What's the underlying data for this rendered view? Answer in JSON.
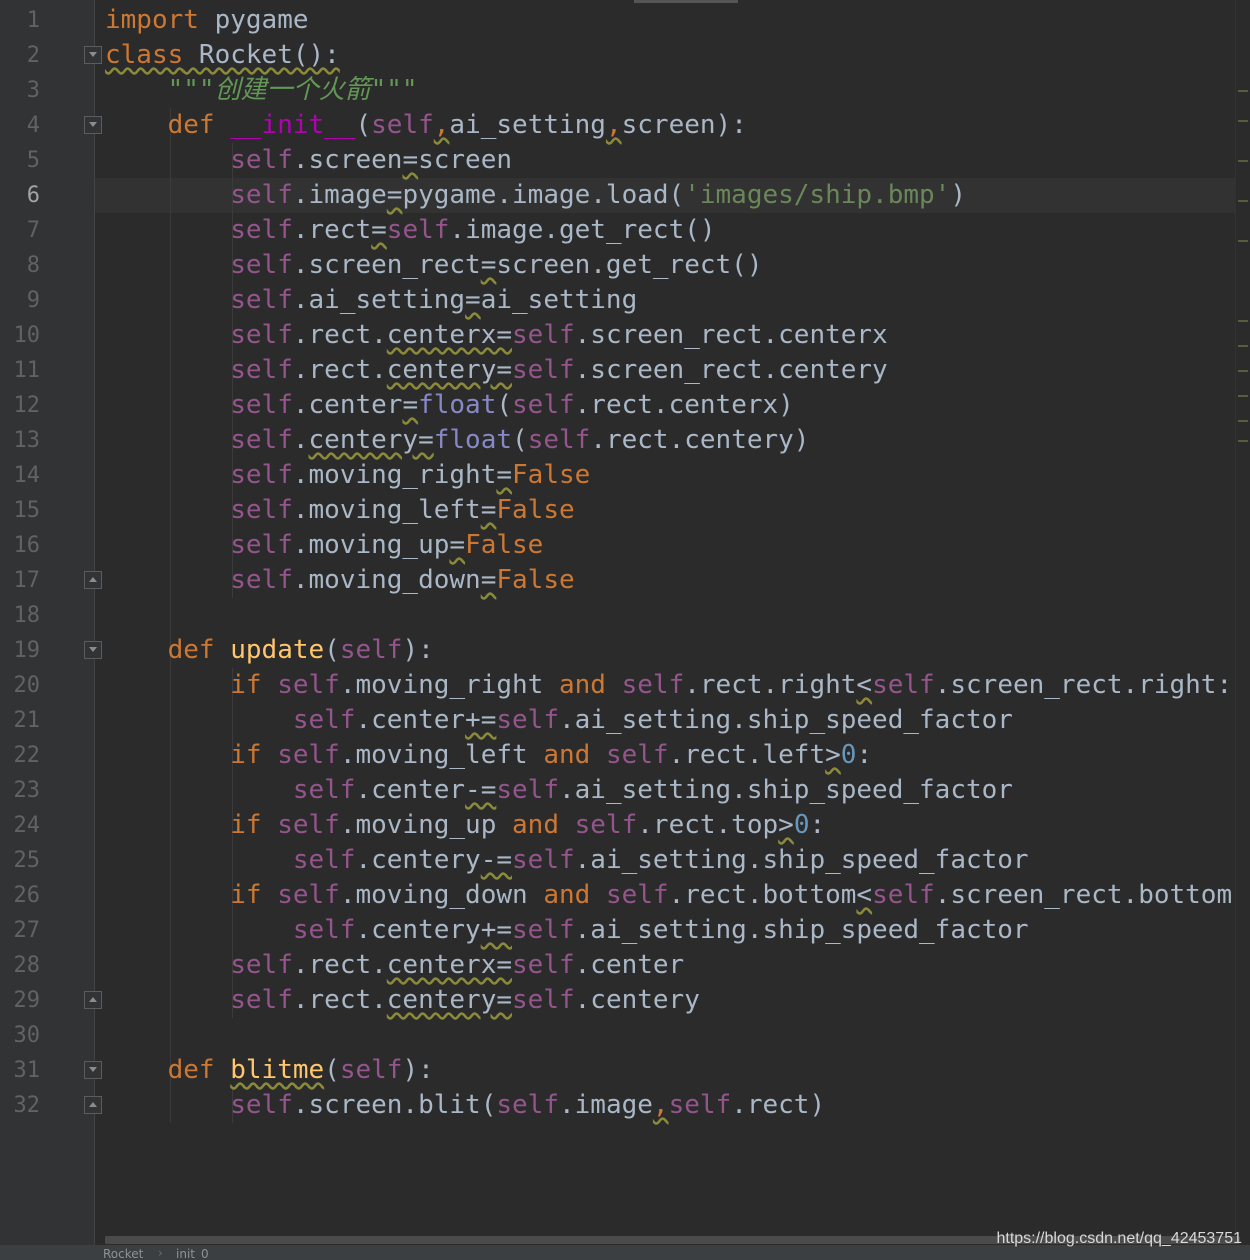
{
  "editor": {
    "line_numbers": [
      "1",
      "2",
      "3",
      "4",
      "5",
      "6",
      "7",
      "8",
      "9",
      "10",
      "11",
      "12",
      "13",
      "14",
      "15",
      "16",
      "17",
      "18",
      "19",
      "20",
      "21",
      "22",
      "23",
      "24",
      "25",
      "26",
      "27",
      "28",
      "29",
      "30",
      "31",
      "32"
    ],
    "current_line": "6",
    "lines": [
      [
        {
          "t": "import",
          "c": "kw"
        },
        {
          "t": " pygame"
        }
      ],
      [
        {
          "t": "class",
          "c": "kw wavy"
        },
        {
          "t": " Rocket():",
          "c": "wavy"
        }
      ],
      [
        {
          "t": "    "
        },
        {
          "t": "\"\"\"创建一个火箭\"\"\"",
          "c": "doc"
        }
      ],
      [
        {
          "t": "    "
        },
        {
          "t": "def",
          "c": "kw"
        },
        {
          "t": " "
        },
        {
          "t": "__init__",
          "c": "magic"
        },
        {
          "t": "("
        },
        {
          "t": "self",
          "c": "self"
        },
        {
          "t": ",",
          "c": "kw wavy"
        },
        {
          "t": "ai_setting"
        },
        {
          "t": ",",
          "c": "kw wavy"
        },
        {
          "t": "screen):"
        }
      ],
      [
        {
          "t": "        "
        },
        {
          "t": "self",
          "c": "self"
        },
        {
          "t": ".screen"
        },
        {
          "t": "=",
          "c": "wavy"
        },
        {
          "t": "screen"
        }
      ],
      [
        {
          "t": "        "
        },
        {
          "t": "self",
          "c": "self"
        },
        {
          "t": ".image"
        },
        {
          "t": "=",
          "c": "wavy"
        },
        {
          "t": "pygame.image.load("
        },
        {
          "t": "'images/ship.bmp'",
          "c": "str"
        },
        {
          "t": ")"
        }
      ],
      [
        {
          "t": "        "
        },
        {
          "t": "self",
          "c": "self"
        },
        {
          "t": ".rect"
        },
        {
          "t": "=",
          "c": "wavy"
        },
        {
          "t": "self",
          "c": "self"
        },
        {
          "t": ".image.get_rect()"
        }
      ],
      [
        {
          "t": "        "
        },
        {
          "t": "self",
          "c": "self"
        },
        {
          "t": ".screen_rect"
        },
        {
          "t": "=",
          "c": "wavy"
        },
        {
          "t": "screen.get_rect()"
        }
      ],
      [
        {
          "t": "        "
        },
        {
          "t": "self",
          "c": "self"
        },
        {
          "t": ".ai_setting"
        },
        {
          "t": "=",
          "c": "wavy"
        },
        {
          "t": "ai_setting"
        }
      ],
      [
        {
          "t": "        "
        },
        {
          "t": "self",
          "c": "self"
        },
        {
          "t": ".rect."
        },
        {
          "t": "centerx=",
          "c": "wavy"
        },
        {
          "t": "self",
          "c": "self"
        },
        {
          "t": ".screen_rect.centerx"
        }
      ],
      [
        {
          "t": "        "
        },
        {
          "t": "self",
          "c": "self"
        },
        {
          "t": ".rect."
        },
        {
          "t": "centery=",
          "c": "wavy"
        },
        {
          "t": "self",
          "c": "self"
        },
        {
          "t": ".screen_rect.centery"
        }
      ],
      [
        {
          "t": "        "
        },
        {
          "t": "self",
          "c": "self"
        },
        {
          "t": ".center"
        },
        {
          "t": "=",
          "c": "wavy"
        },
        {
          "t": "float",
          "c": "bi"
        },
        {
          "t": "("
        },
        {
          "t": "self",
          "c": "self"
        },
        {
          "t": ".rect.centerx)"
        }
      ],
      [
        {
          "t": "        "
        },
        {
          "t": "self",
          "c": "self"
        },
        {
          "t": "."
        },
        {
          "t": "centery=",
          "c": "wavy"
        },
        {
          "t": "float",
          "c": "bi"
        },
        {
          "t": "("
        },
        {
          "t": "self",
          "c": "self"
        },
        {
          "t": ".rect.centery)"
        }
      ],
      [
        {
          "t": "        "
        },
        {
          "t": "self",
          "c": "self"
        },
        {
          "t": ".moving_right"
        },
        {
          "t": "=",
          "c": "wavy"
        },
        {
          "t": "False",
          "c": "kw"
        }
      ],
      [
        {
          "t": "        "
        },
        {
          "t": "self",
          "c": "self"
        },
        {
          "t": ".moving_left"
        },
        {
          "t": "=",
          "c": "wavy"
        },
        {
          "t": "False",
          "c": "kw"
        }
      ],
      [
        {
          "t": "        "
        },
        {
          "t": "self",
          "c": "self"
        },
        {
          "t": ".moving_up"
        },
        {
          "t": "=",
          "c": "wavy"
        },
        {
          "t": "False",
          "c": "kw"
        }
      ],
      [
        {
          "t": "        "
        },
        {
          "t": "self",
          "c": "self"
        },
        {
          "t": ".moving_down"
        },
        {
          "t": "=",
          "c": "wavy"
        },
        {
          "t": "False",
          "c": "kw"
        }
      ],
      [
        {
          "t": ""
        }
      ],
      [
        {
          "t": "    "
        },
        {
          "t": "def",
          "c": "kw"
        },
        {
          "t": " "
        },
        {
          "t": "update",
          "c": "fn"
        },
        {
          "t": "("
        },
        {
          "t": "self",
          "c": "self"
        },
        {
          "t": "):"
        }
      ],
      [
        {
          "t": "        "
        },
        {
          "t": "if",
          "c": "kw"
        },
        {
          "t": " "
        },
        {
          "t": "self",
          "c": "self"
        },
        {
          "t": ".moving_right "
        },
        {
          "t": "and",
          "c": "kw"
        },
        {
          "t": " "
        },
        {
          "t": "self",
          "c": "self"
        },
        {
          "t": ".rect.right"
        },
        {
          "t": "<",
          "c": "wavy"
        },
        {
          "t": "self",
          "c": "self"
        },
        {
          "t": ".screen_rect.right:"
        }
      ],
      [
        {
          "t": "            "
        },
        {
          "t": "self",
          "c": "self"
        },
        {
          "t": ".center"
        },
        {
          "t": "+=",
          "c": "wavy"
        },
        {
          "t": "self",
          "c": "self"
        },
        {
          "t": ".ai_setting.ship_speed_factor"
        }
      ],
      [
        {
          "t": "        "
        },
        {
          "t": "if",
          "c": "kw"
        },
        {
          "t": " "
        },
        {
          "t": "self",
          "c": "self"
        },
        {
          "t": ".moving_left "
        },
        {
          "t": "and",
          "c": "kw"
        },
        {
          "t": " "
        },
        {
          "t": "self",
          "c": "self"
        },
        {
          "t": ".rect.left"
        },
        {
          "t": ">",
          "c": "wavy"
        },
        {
          "t": "0",
          "c": "num"
        },
        {
          "t": ":"
        }
      ],
      [
        {
          "t": "            "
        },
        {
          "t": "self",
          "c": "self"
        },
        {
          "t": ".center"
        },
        {
          "t": "-=",
          "c": "wavy"
        },
        {
          "t": "self",
          "c": "self"
        },
        {
          "t": ".ai_setting.ship_speed_factor"
        }
      ],
      [
        {
          "t": "        "
        },
        {
          "t": "if",
          "c": "kw"
        },
        {
          "t": " "
        },
        {
          "t": "self",
          "c": "self"
        },
        {
          "t": ".moving_up "
        },
        {
          "t": "and",
          "c": "kw"
        },
        {
          "t": " "
        },
        {
          "t": "self",
          "c": "self"
        },
        {
          "t": ".rect.top"
        },
        {
          "t": ">",
          "c": "wavy"
        },
        {
          "t": "0",
          "c": "num"
        },
        {
          "t": ":"
        }
      ],
      [
        {
          "t": "            "
        },
        {
          "t": "self",
          "c": "self"
        },
        {
          "t": ".centery"
        },
        {
          "t": "-=",
          "c": "wavy"
        },
        {
          "t": "self",
          "c": "self"
        },
        {
          "t": ".ai_setting.ship_speed_factor"
        }
      ],
      [
        {
          "t": "        "
        },
        {
          "t": "if",
          "c": "kw"
        },
        {
          "t": " "
        },
        {
          "t": "self",
          "c": "self"
        },
        {
          "t": ".moving_down "
        },
        {
          "t": "and",
          "c": "kw"
        },
        {
          "t": " "
        },
        {
          "t": "self",
          "c": "self"
        },
        {
          "t": ".rect.bottom"
        },
        {
          "t": "<",
          "c": "wavy"
        },
        {
          "t": "self",
          "c": "self"
        },
        {
          "t": ".screen_rect.bottom"
        }
      ],
      [
        {
          "t": "            "
        },
        {
          "t": "self",
          "c": "self"
        },
        {
          "t": ".centery"
        },
        {
          "t": "+=",
          "c": "wavy"
        },
        {
          "t": "self",
          "c": "self"
        },
        {
          "t": ".ai_setting.ship_speed_factor"
        }
      ],
      [
        {
          "t": "        "
        },
        {
          "t": "self",
          "c": "self"
        },
        {
          "t": ".rect."
        },
        {
          "t": "centerx=",
          "c": "wavy"
        },
        {
          "t": "self",
          "c": "self"
        },
        {
          "t": ".center"
        }
      ],
      [
        {
          "t": "        "
        },
        {
          "t": "self",
          "c": "self"
        },
        {
          "t": ".rect."
        },
        {
          "t": "centery=",
          "c": "wavy"
        },
        {
          "t": "self",
          "c": "self"
        },
        {
          "t": ".centery"
        }
      ],
      [
        {
          "t": ""
        }
      ],
      [
        {
          "t": "    "
        },
        {
          "t": "def",
          "c": "kw"
        },
        {
          "t": " "
        },
        {
          "t": "blitme",
          "c": "fn wavy"
        },
        {
          "t": "("
        },
        {
          "t": "self",
          "c": "self"
        },
        {
          "t": "):"
        }
      ],
      [
        {
          "t": "        "
        },
        {
          "t": "self",
          "c": "self"
        },
        {
          "t": ".screen.blit("
        },
        {
          "t": "self",
          "c": "self"
        },
        {
          "t": ".image"
        },
        {
          "t": ",",
          "c": "kw wavy"
        },
        {
          "t": "self",
          "c": "self"
        },
        {
          "t": ".rect)"
        }
      ]
    ]
  },
  "breadcrumb": {
    "class_name": "Rocket",
    "separator": "›",
    "method_name": "init_0"
  },
  "watermark": "https://blog.csdn.net/qq_42453751",
  "colors": {
    "background": "#2b2b2b",
    "gutter": "#313335",
    "keyword": "#cc7832",
    "self": "#94558d",
    "function": "#ffc66d",
    "string": "#6a8759",
    "number": "#6897bb"
  }
}
